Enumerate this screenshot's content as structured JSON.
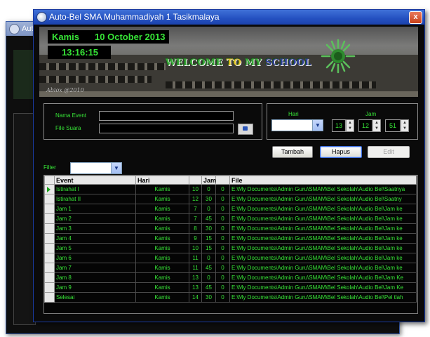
{
  "background_window": {
    "title": "Auto-"
  },
  "window": {
    "title": "Auto-Bel SMA Muhammadiyah 1 Tasikmalaya",
    "close_label": "x"
  },
  "banner": {
    "day": "Kamis",
    "date": "10 October 2013",
    "time": "13:16:15",
    "welcome": [
      "WELCOME",
      "TO",
      "MY",
      "SCHOOL"
    ],
    "signature": "Abiox @2010"
  },
  "form": {
    "nama_event_label": "Nama Event",
    "nama_event_value": "",
    "file_suara_label": "File Suara",
    "file_suara_value": "",
    "hari_label": "Hari",
    "hari_value": "",
    "jam_label": "Jam",
    "hour": "13",
    "minute": "12",
    "second": "51"
  },
  "buttons": {
    "tambah": "Tambah",
    "hapus": "Hapus",
    "edit": "Edit"
  },
  "filter": {
    "label": "Filter",
    "value": ""
  },
  "table": {
    "columns": [
      "Event",
      "Hari",
      "Jam",
      "",
      "File"
    ],
    "rows": [
      {
        "event": "Istirahat I",
        "hari": "Kamis",
        "h": "10",
        "m": "0",
        "s": "0",
        "file": "E:\\My Documents\\Admin Guru\\SMAM\\Bel Sekolah\\Audio Bel\\Saatnya"
      },
      {
        "event": "Istirahat II",
        "hari": "Kamis",
        "h": "12",
        "m": "30",
        "s": "0",
        "file": "E:\\My Documents\\Admin Guru\\SMAM\\Bel Sekolah\\Audio Bel\\Saatny"
      },
      {
        "event": "Jam 1",
        "hari": "Kamis",
        "h": "7",
        "m": "0",
        "s": "0",
        "file": "E:\\My Documents\\Admin Guru\\SMAM\\Bel Sekolah\\Audio Bel\\Jam ke"
      },
      {
        "event": "Jam 2",
        "hari": "Kamis",
        "h": "7",
        "m": "45",
        "s": "0",
        "file": "E:\\My Documents\\Admin Guru\\SMAM\\Bel Sekolah\\Audio Bel\\Jam ke"
      },
      {
        "event": "Jam 3",
        "hari": "Kamis",
        "h": "8",
        "m": "30",
        "s": "0",
        "file": "E:\\My Documents\\Admin Guru\\SMAM\\Bel Sekolah\\Audio Bel\\Jam ke"
      },
      {
        "event": "Jam 4",
        "hari": "Kamis",
        "h": "9",
        "m": "15",
        "s": "0",
        "file": "E:\\My Documents\\Admin Guru\\SMAM\\Bel Sekolah\\Audio Bel\\Jam ke"
      },
      {
        "event": "Jam 5",
        "hari": "Kamis",
        "h": "10",
        "m": "15",
        "s": "0",
        "file": "E:\\My Documents\\Admin Guru\\SMAM\\Bel Sekolah\\Audio Bel\\Jam ke"
      },
      {
        "event": "Jam 6",
        "hari": "Kamis",
        "h": "11",
        "m": "0",
        "s": "0",
        "file": "E:\\My Documents\\Admin Guru\\SMAM\\Bel Sekolah\\Audio Bel\\Jam ke"
      },
      {
        "event": "Jam 7",
        "hari": "Kamis",
        "h": "11",
        "m": "45",
        "s": "0",
        "file": "E:\\My Documents\\Admin Guru\\SMAM\\Bel Sekolah\\Audio Bel\\Jam ke"
      },
      {
        "event": "Jam 8",
        "hari": "Kamis",
        "h": "13",
        "m": "0",
        "s": "0",
        "file": "E:\\My Documents\\Admin Guru\\SMAM\\Bel Sekolah\\Audio Bel\\Jam Ke"
      },
      {
        "event": "Jam 9",
        "hari": "Kamis",
        "h": "13",
        "m": "45",
        "s": "0",
        "file": "E:\\My Documents\\Admin Guru\\SMAM\\Bel Sekolah\\Audio Bel\\Jam Ke"
      },
      {
        "event": "Selesai",
        "hari": "Kamis",
        "h": "14",
        "m": "30",
        "s": "0",
        "file": "E:\\My Documents\\Admin Guru\\SMAM\\Bel Sekolah\\Audio Bel\\Pel tlah"
      }
    ]
  },
  "colors": {
    "text_green": "#37e537",
    "titlebar_blue": "#2450c0",
    "window_bg": "#0a0a0a"
  }
}
